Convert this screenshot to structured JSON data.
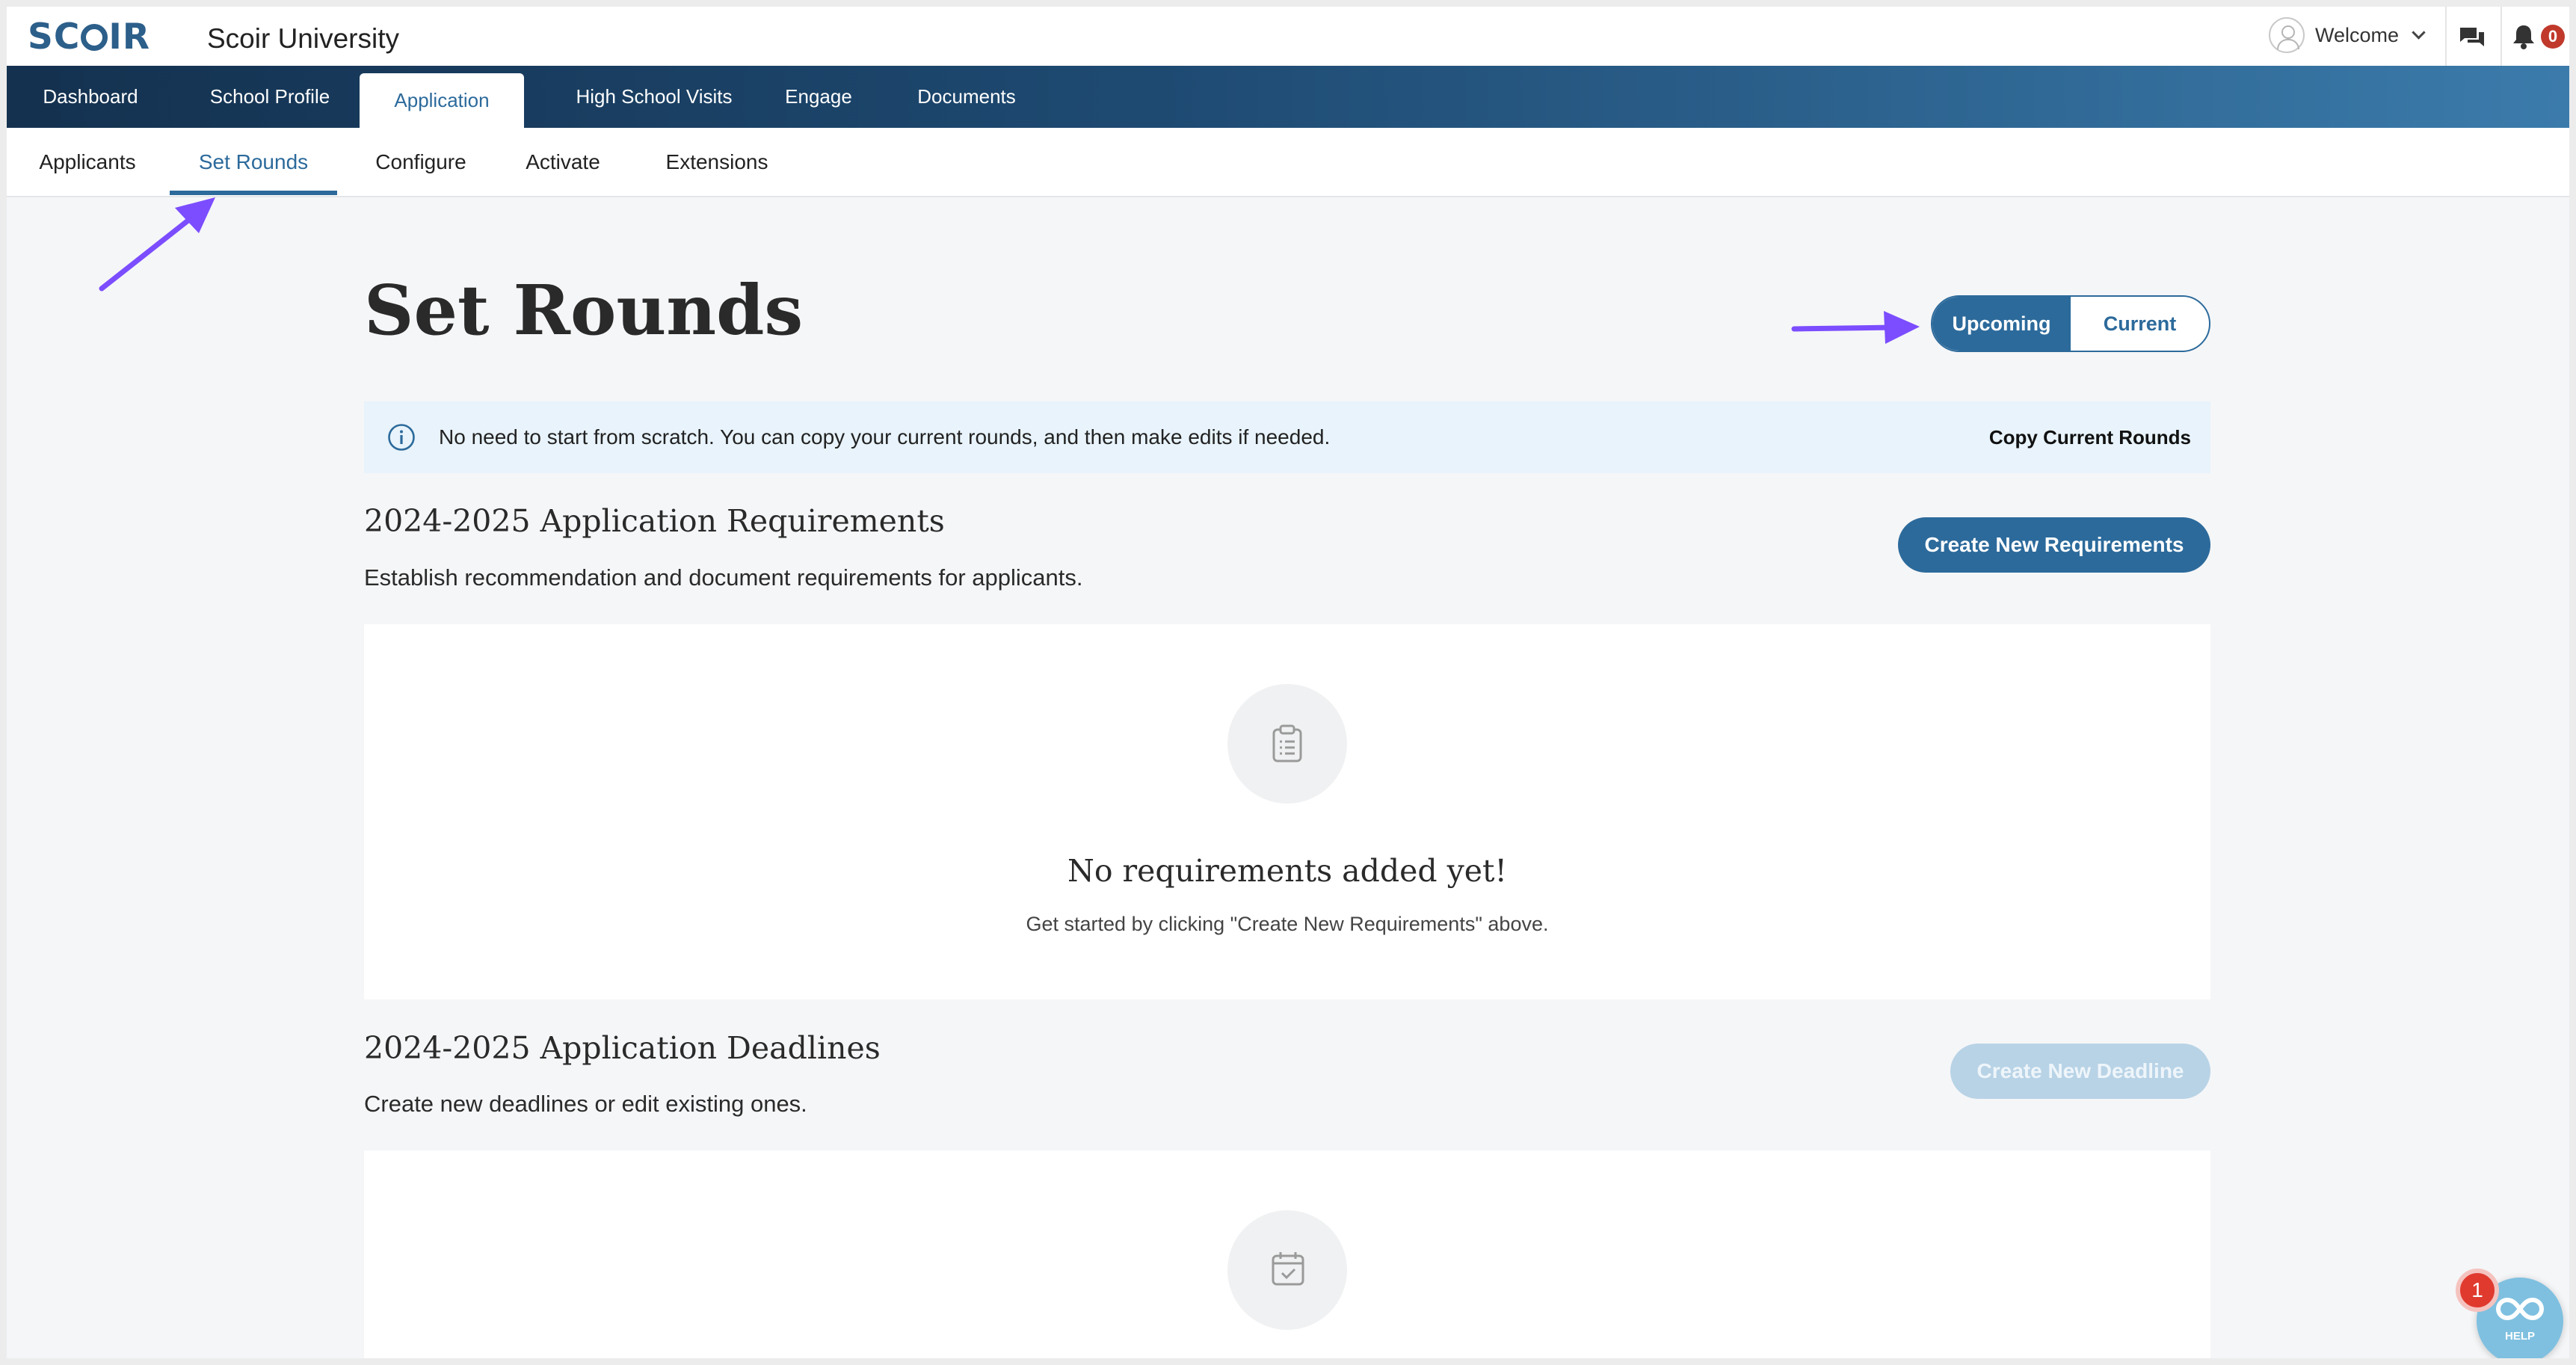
{
  "app": {
    "logo_prefix": "SC",
    "logo_suffix": "IR",
    "university": "Scoir University",
    "welcome": "Welcome",
    "notification_count": "0"
  },
  "main_nav": [
    {
      "label": "Dashboard",
      "active": false
    },
    {
      "label": "School Profile",
      "active": false
    },
    {
      "label": "Application",
      "active": true
    },
    {
      "label": "High School Visits",
      "active": false
    },
    {
      "label": "Engage",
      "active": false
    },
    {
      "label": "Documents",
      "active": false
    }
  ],
  "sub_nav": [
    {
      "label": "Applicants",
      "active": false
    },
    {
      "label": "Set Rounds",
      "active": true
    },
    {
      "label": "Configure",
      "active": false
    },
    {
      "label": "Activate",
      "active": false
    },
    {
      "label": "Extensions",
      "active": false
    }
  ],
  "page": {
    "title": "Set Rounds",
    "toggle": {
      "upcoming": "Upcoming",
      "current": "Current",
      "selected": "Upcoming"
    }
  },
  "info_banner": {
    "text": "No need to start from scratch. You can copy your current rounds, and then make edits if needed.",
    "action": "Copy Current Rounds"
  },
  "requirements": {
    "title": "2024-2025 Application Requirements",
    "description": "Establish recommendation and document requirements for applicants.",
    "button": "Create New Requirements",
    "empty_title": "No requirements added yet!",
    "empty_desc": "Get started by clicking \"Create New Requirements\" above."
  },
  "deadlines": {
    "title": "2024-2025 Application Deadlines",
    "description": "Create new deadlines or edit existing ones.",
    "button": "Create New Deadline"
  },
  "help": {
    "label": "HELP",
    "badge": "1"
  },
  "colors": {
    "brand": "#2c6a9b",
    "nav_dark": "#14314f",
    "annotation_arrow": "#7b4dff"
  }
}
